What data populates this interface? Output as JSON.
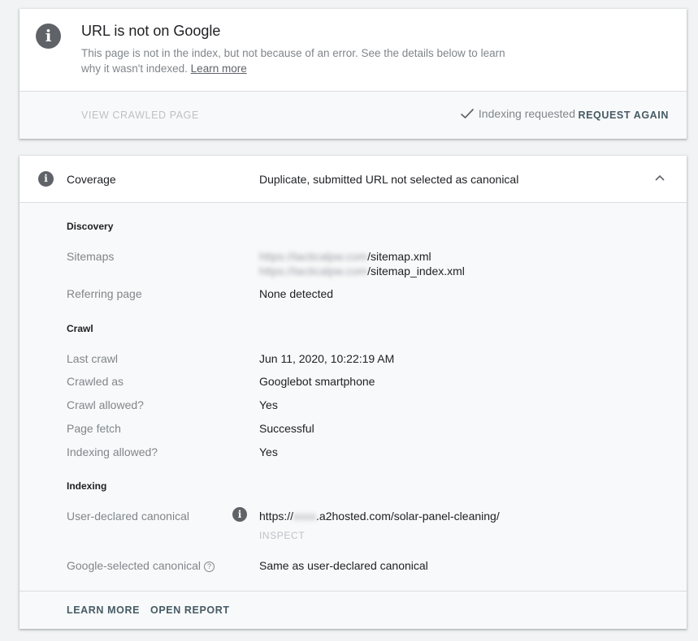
{
  "status": {
    "icon": "info-icon",
    "title": "URL is not on Google",
    "description": "This page is not in the index, but not because of an error. See the details below to learn why it wasn't indexed.",
    "learn_more_link": "Learn more",
    "view_crawled": "VIEW CRAWLED PAGE",
    "indexing_requested": "Indexing requested",
    "request_again": "REQUEST AGAIN"
  },
  "coverage": {
    "icon": "info-icon",
    "label": "Coverage",
    "value": "Duplicate, submitted URL not selected as canonical",
    "chevron": "chevron-up-icon"
  },
  "discovery": {
    "heading": "Discovery",
    "sitemaps_label": "Sitemaps",
    "sitemap_1_host": "https://tacticalpw.com",
    "sitemap_1_path": "/sitemap.xml",
    "sitemap_2_host": "https://tacticalpw.com",
    "sitemap_2_path": "/sitemap_index.xml",
    "referring_label": "Referring page",
    "referring_value": "None detected"
  },
  "crawl": {
    "heading": "Crawl",
    "last_crawl_label": "Last crawl",
    "last_crawl_value": "Jun 11, 2020, 10:22:19 AM",
    "crawled_as_label": "Crawled as",
    "crawled_as_value": "Googlebot smartphone",
    "crawl_allowed_label": "Crawl allowed?",
    "crawl_allowed_value": "Yes",
    "page_fetch_label": "Page fetch",
    "page_fetch_value": "Successful",
    "indexing_allowed_label": "Indexing allowed?",
    "indexing_allowed_value": "Yes"
  },
  "indexing": {
    "heading": "Indexing",
    "user_canonical_label": "User-declared canonical",
    "user_canonical_prefix": "https://",
    "user_canonical_blur": "xxxx",
    "user_canonical_rest": ".a2hosted.com/solar-panel-cleaning/",
    "inspect": "INSPECT",
    "google_canonical_label": "Google-selected canonical",
    "help_icon": "?",
    "google_canonical_value": "Same as user-declared canonical"
  },
  "footer": {
    "learn_more": "LEARN MORE",
    "open_report": "OPEN REPORT"
  },
  "colors": {
    "accent": "#455a64",
    "muted_text": "#80868b",
    "icon_gray": "#5f6368",
    "panel_bg": "#f8f9fa"
  }
}
